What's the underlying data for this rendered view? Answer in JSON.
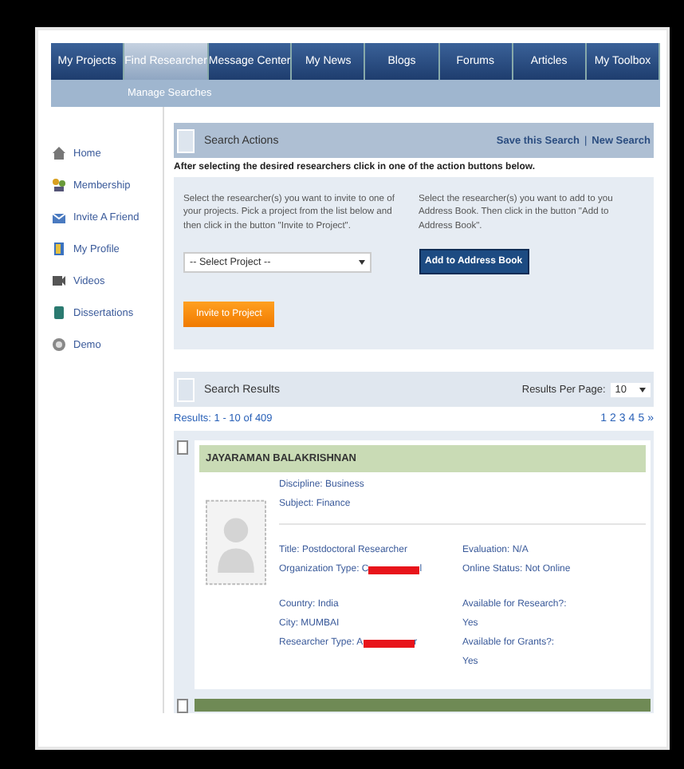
{
  "nav": {
    "tabs": [
      {
        "label": "My Projects",
        "selected": false
      },
      {
        "label": "Find Researcher",
        "selected": true
      },
      {
        "label": "Message Center",
        "selected": false
      },
      {
        "label": "My News",
        "selected": false
      },
      {
        "label": "Blogs",
        "selected": false
      },
      {
        "label": "Forums",
        "selected": false
      },
      {
        "label": "Articles",
        "selected": false
      },
      {
        "label": "My Toolbox",
        "selected": false
      }
    ],
    "subnav": "Manage Searches"
  },
  "sidebar": {
    "items": [
      {
        "label": "Home"
      },
      {
        "label": "Membership"
      },
      {
        "label": "Invite A Friend"
      },
      {
        "label": "My Profile"
      },
      {
        "label": "Videos"
      },
      {
        "label": "Dissertations"
      },
      {
        "label": "Demo"
      }
    ]
  },
  "search_actions": {
    "title": "Search Actions",
    "links": [
      "Save this Search",
      "New Search"
    ],
    "link_separator": "|",
    "instruction": "After selecting the desired researchers click in one of the action buttons below.",
    "invite_text": "Select the researcher(s) you want to invite to one of your projects. Pick a project from the list below and then click in the button \"Invite to Project\".",
    "project_select": "-- Select Project --",
    "invite_button": "Invite to Project",
    "address_text": "Select the researcher(s) you want to add to you Address Book. Then click in the button \"Add to Address Book\".",
    "address_button": "Add to Address Book"
  },
  "search_results": {
    "title": "Search Results",
    "per_page_label": "Results Per Page:",
    "per_page": "10",
    "summary": "Results: 1 - 10 of 409",
    "pages": [
      "1",
      "2",
      "3",
      "4",
      "5",
      "»"
    ]
  },
  "results": [
    {
      "name": "JAYARAMAN BALAKRISHNAN",
      "checked": false,
      "top": [
        {
          "label": "Discipline:",
          "value": "Business"
        },
        {
          "label": "Subject:",
          "value": "Finance"
        }
      ],
      "left1": [
        {
          "label": "Title:",
          "value": "Postdoctoral Researcher",
          "redacted": false
        },
        {
          "label": "Organization Type:",
          "value": "C",
          "redacted": true,
          "tail": "l"
        }
      ],
      "right1": [
        {
          "label": "Evaluation:",
          "value": "N/A"
        },
        {
          "label": "Online Status:",
          "value": "Not Online"
        }
      ],
      "left2": [
        {
          "label": "Country:",
          "value": "India",
          "redacted": false
        },
        {
          "label": "City:",
          "value": "MUMBAI",
          "redacted": false
        },
        {
          "label": "Researcher Type:",
          "value": "A",
          "redacted": true,
          "tail": "r"
        }
      ],
      "right2": [
        "Available for Research?:",
        "Yes",
        "Available for Grants?:",
        "Yes"
      ]
    }
  ],
  "next_result": {
    "checked": false
  }
}
